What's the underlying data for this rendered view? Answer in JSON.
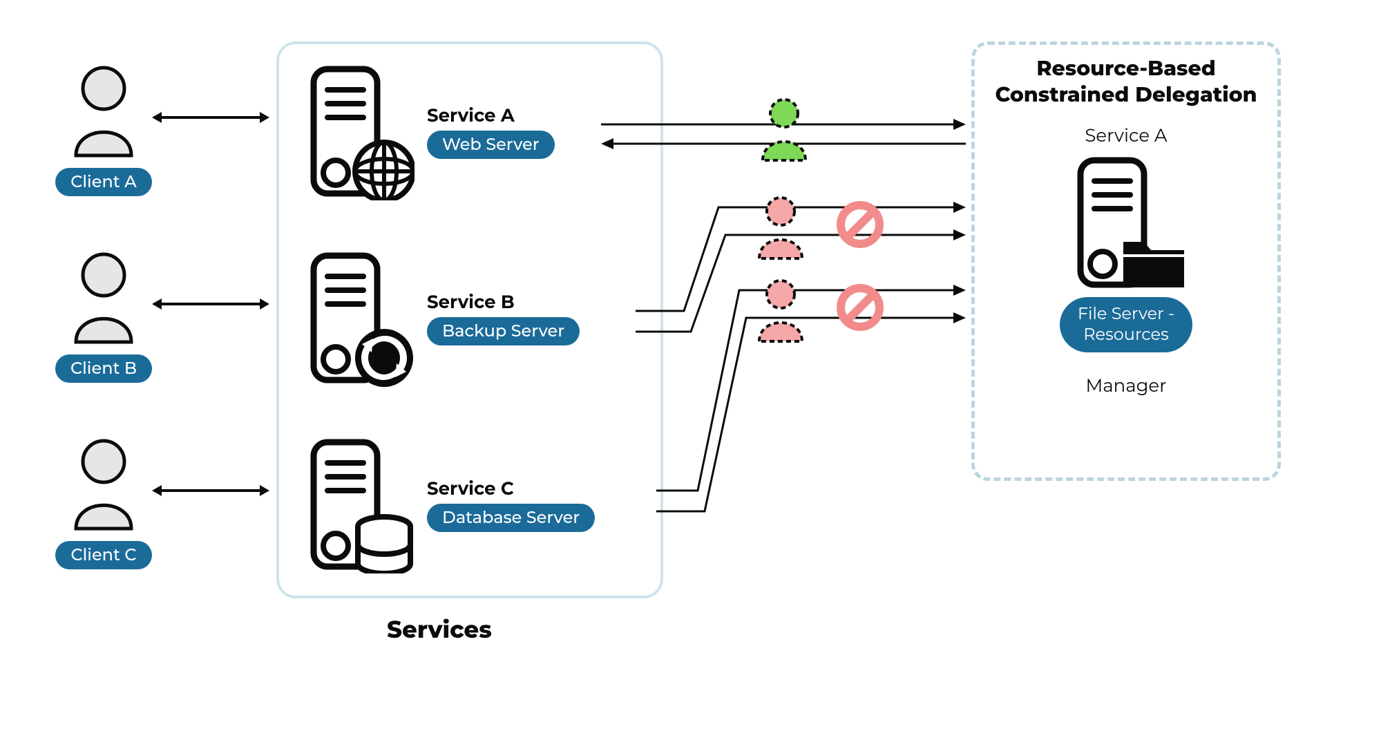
{
  "clients": {
    "a": "Client A",
    "b": "Client B",
    "c": "Client C"
  },
  "services_group_label": "Services",
  "services": {
    "a": {
      "title": "Service A",
      "label": "Web Server"
    },
    "b": {
      "title": "Service B",
      "label": "Backup Server"
    },
    "c": {
      "title": "Service C",
      "label": "Database Server"
    }
  },
  "rbcd": {
    "title": "Resource-Based Constrained Delegation",
    "service_label": "Service A",
    "resource_label_line1": "File Server -",
    "resource_label_line2": "Resources",
    "manager_label": "Manager"
  },
  "colors": {
    "pill": "#1b6b99",
    "allow": "#7ed957",
    "deny": "#f28b8b",
    "box": "#cfe3eb",
    "dashbox": "#bcd5df"
  }
}
